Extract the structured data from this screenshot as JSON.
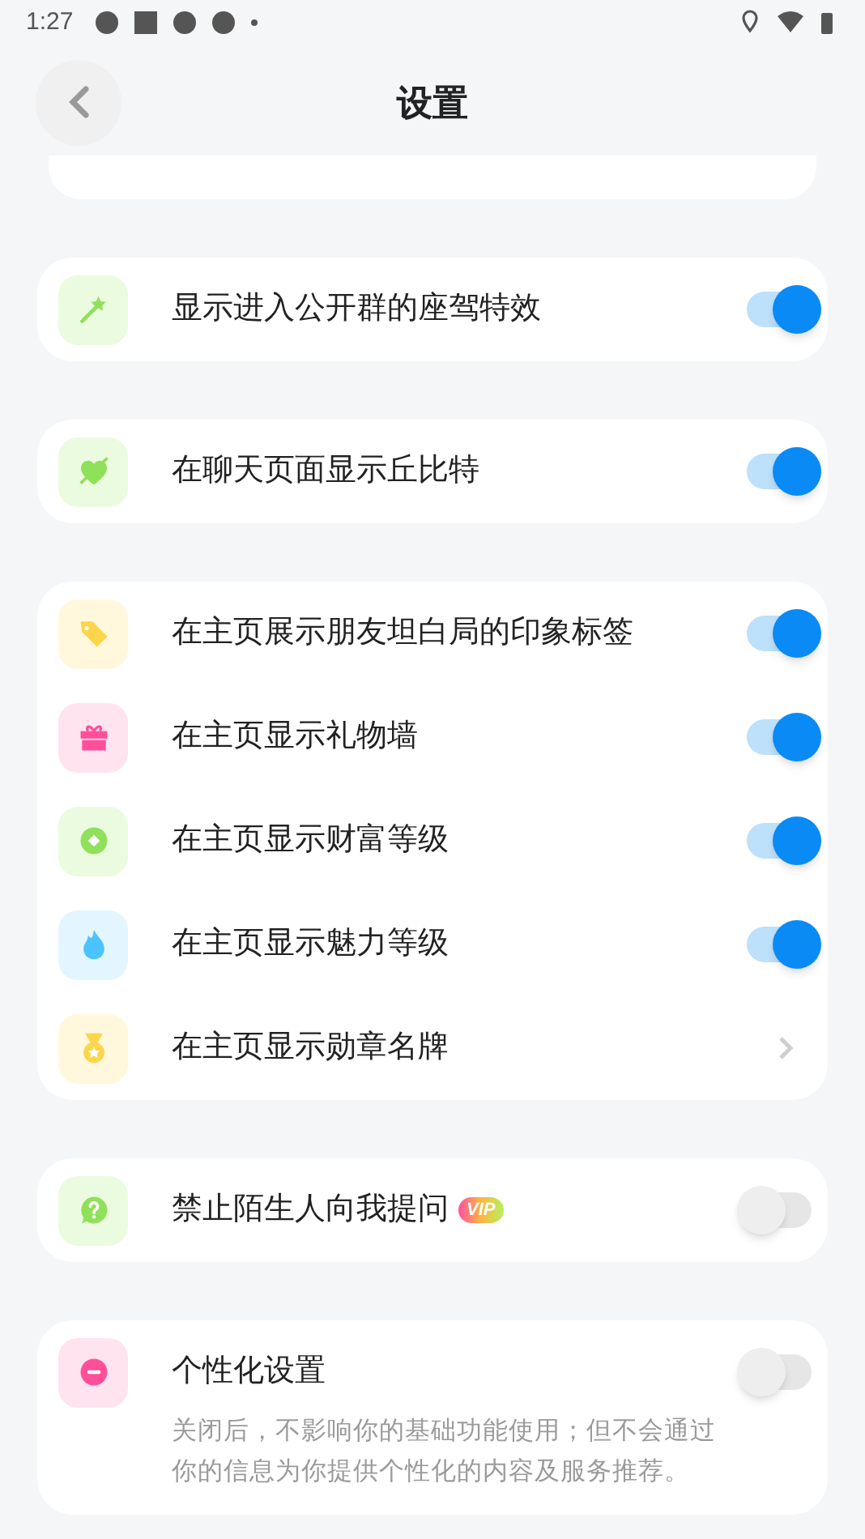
{
  "status_bar": {
    "time": "1:27"
  },
  "header": {
    "title": "设置"
  },
  "groups": [
    {
      "items": [
        {
          "label": "显示进入公开群的座驾特效",
          "kind": "toggle",
          "on": true
        }
      ]
    },
    {
      "items": [
        {
          "label": "在聊天页面显示丘比特",
          "kind": "toggle",
          "on": true
        }
      ]
    },
    {
      "items": [
        {
          "label": "在主页展示朋友坦白局的印象标签",
          "kind": "toggle",
          "on": true
        },
        {
          "label": "在主页显示礼物墙",
          "kind": "toggle",
          "on": true
        },
        {
          "label": "在主页显示财富等级",
          "kind": "toggle",
          "on": true
        },
        {
          "label": "在主页显示魅力等级",
          "kind": "toggle",
          "on": true
        },
        {
          "label": "在主页显示勋章名牌",
          "kind": "link"
        }
      ]
    },
    {
      "items": [
        {
          "label": "禁止陌生人向我提问",
          "badge": "VIP",
          "kind": "toggle",
          "on": false
        }
      ]
    },
    {
      "items": [
        {
          "label": "个性化设置",
          "description": "关闭后，不影响你的基础功能使用；但不会通过你的信息为你提供个性化的内容及服务推荐。",
          "kind": "toggle",
          "on": false
        }
      ]
    }
  ]
}
